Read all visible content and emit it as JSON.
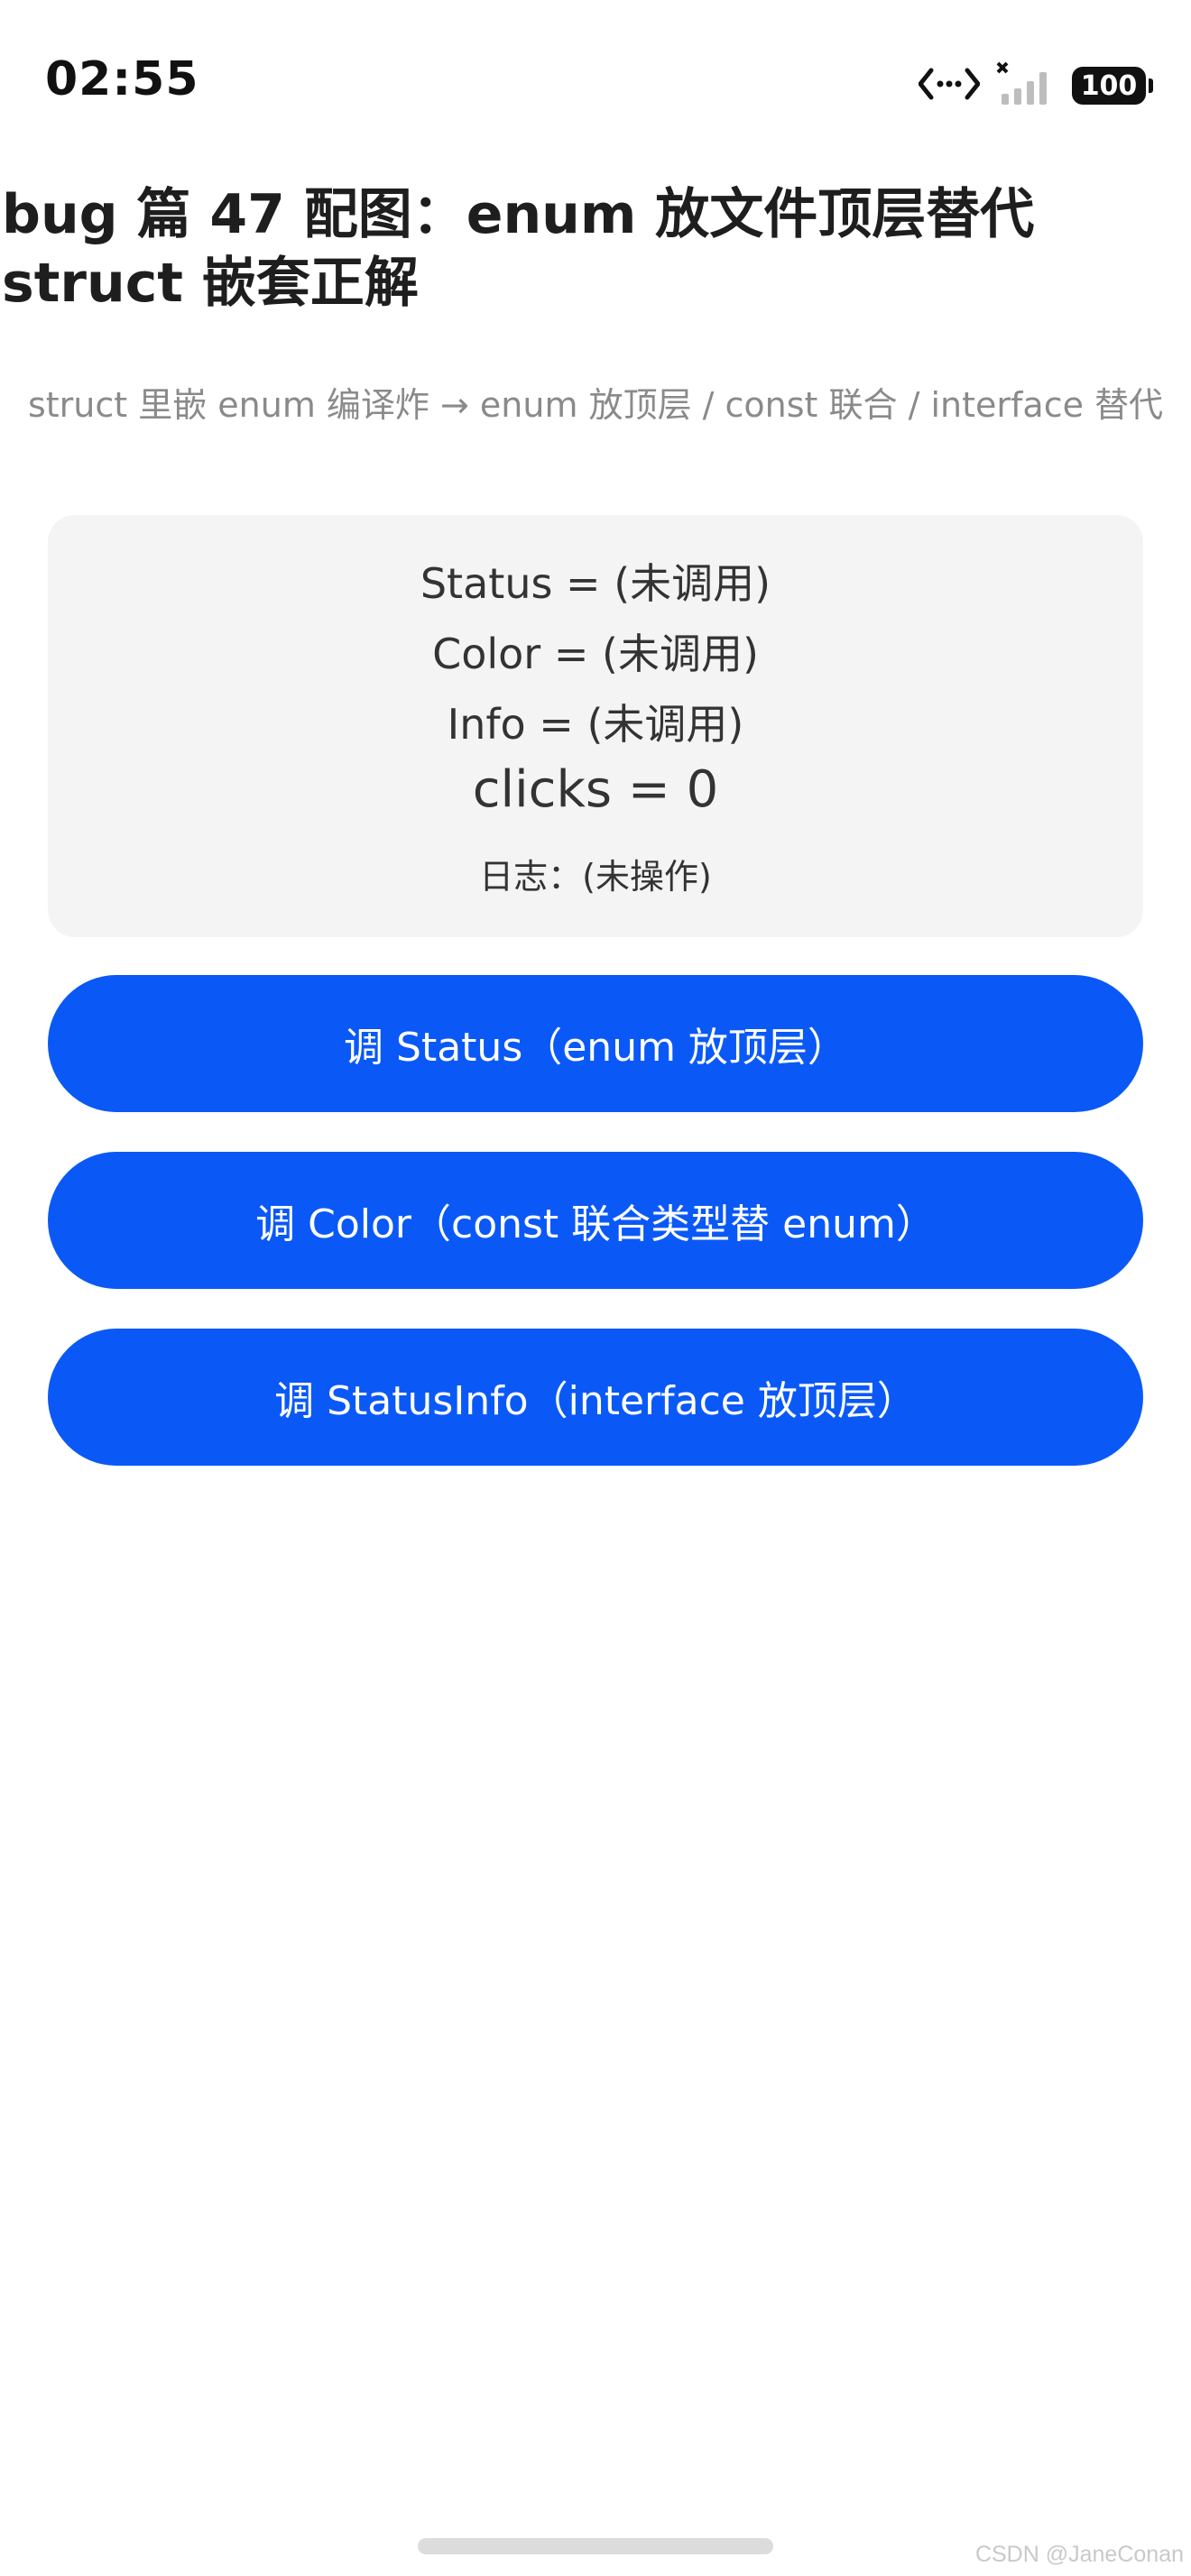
{
  "status_bar": {
    "time": "02:55",
    "icons": [
      "data-transfer-icon",
      "signal-no-service-icon",
      "battery-icon"
    ],
    "battery_level": "100"
  },
  "header": {
    "title": "bug 篇 47 配图：enum 放文件顶层替代 struct 嵌套正解",
    "subtitle": "struct 里嵌 enum 编译炸 → enum 放顶层 / const 联合 / interface 替代"
  },
  "info_card": {
    "status_line": "Status = (未调用)",
    "color_line": "Color = (未调用)",
    "info_line": "Info = (未调用)",
    "clicks_line": "clicks = 0",
    "log_line": "日志：(未操作)"
  },
  "buttons": {
    "status": "调 Status（enum 放顶层）",
    "color": "调 Color（const 联合类型替 enum）",
    "status_info": "调 StatusInfo（interface 放顶层）"
  },
  "colors": {
    "accent": "#0a59f7",
    "card_bg": "#f4f4f4",
    "subtitle": "#8a8a8a"
  },
  "watermark": "CSDN @JaneConan"
}
